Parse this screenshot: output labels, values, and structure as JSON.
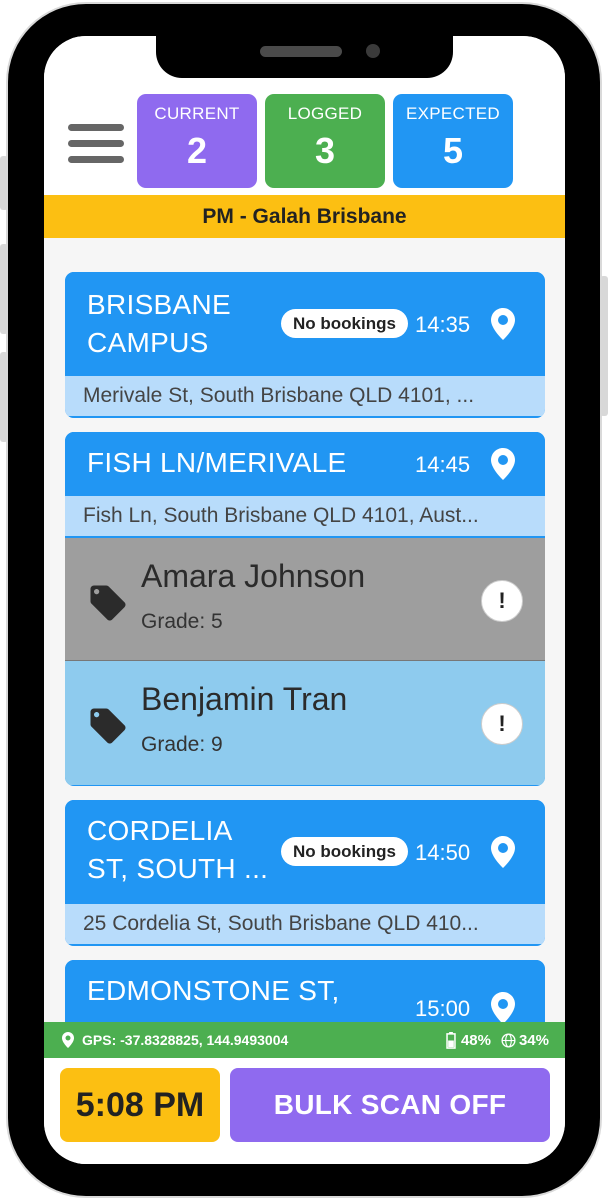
{
  "counters": {
    "current": {
      "label": "CURRENT",
      "value": "2",
      "color": "#8f6aef"
    },
    "logged": {
      "label": "LOGGED",
      "value": "3",
      "color": "#4caf50"
    },
    "expected": {
      "label": "EXPECTED",
      "value": "5",
      "color": "#2196f3"
    }
  },
  "route_banner": "PM - Galah Brisbane",
  "stops": [
    {
      "name_line1": "BRISBANE",
      "name_line2": "CAMPUS",
      "badge": "No bookings",
      "time": "14:35",
      "address": "Merivale St, South Brisbane QLD 4101, ..."
    },
    {
      "name_line1": "FISH LN/MERIVALE",
      "time": "14:45",
      "address": "Fish Ln, South Brisbane QLD 4101, Aust...",
      "passengers": [
        {
          "name": "Amara Johnson",
          "grade": "Grade: 5",
          "alert": "!",
          "bg": "#9e9e9e"
        },
        {
          "name": "Benjamin Tran",
          "grade": "Grade: 9",
          "alert": "!",
          "bg": "#8ecbee"
        }
      ]
    },
    {
      "name_line1": "CORDELIA",
      "name_line2": "ST, SOUTH ...",
      "badge": "No bookings",
      "time": "14:50",
      "address": "25 Cordelia St, South Brisbane QLD 410..."
    },
    {
      "name_line1": "EDMONSTONE ST,",
      "time": "15:00"
    }
  ],
  "status": {
    "gps": "GPS: -37.8328825, 144.9493004",
    "battery": "48%",
    "signal": "34%"
  },
  "clock": "5:08 PM",
  "bulk_scan_label": "BULK SCAN OFF"
}
